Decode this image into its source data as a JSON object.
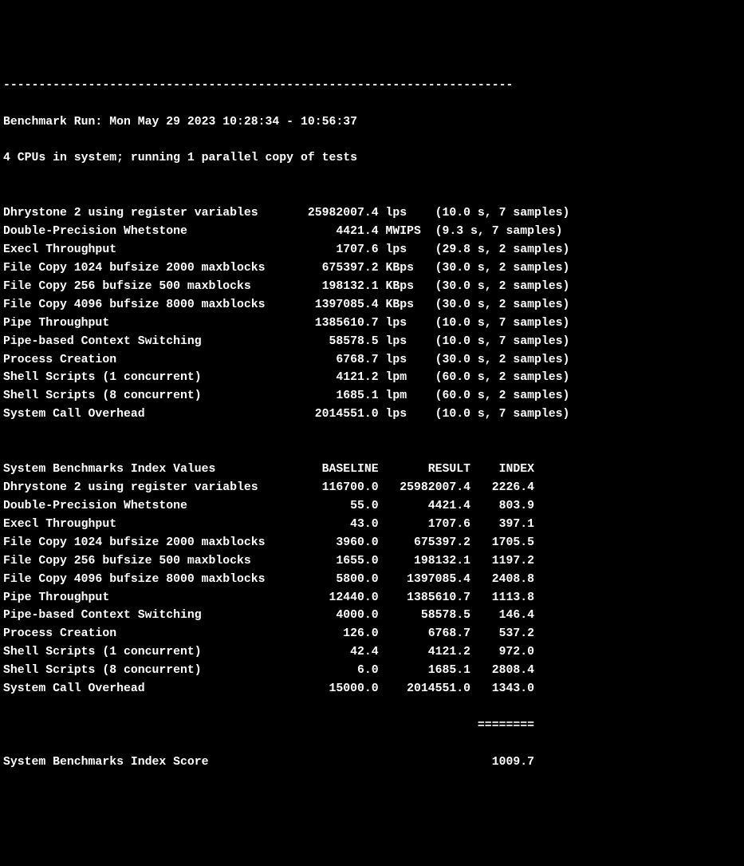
{
  "dashes_header": "------------------------------------------------------------------------",
  "run_info": "Benchmark Run: Mon May 29 2023 10:28:34 - 10:56:37",
  "cpu_info": "4 CPUs in system; running 1 parallel copy of tests",
  "blank": "",
  "results": [
    {
      "name": "Dhrystone 2 using register variables",
      "value": "25982007.4",
      "unit": "lps",
      "timing": "(10.0 s, 7 samples)"
    },
    {
      "name": "Double-Precision Whetstone",
      "value": "4421.4",
      "unit": "MWIPS",
      "timing": "(9.3 s, 7 samples)"
    },
    {
      "name": "Execl Throughput",
      "value": "1707.6",
      "unit": "lps",
      "timing": "(29.8 s, 2 samples)"
    },
    {
      "name": "File Copy 1024 bufsize 2000 maxblocks",
      "value": "675397.2",
      "unit": "KBps",
      "timing": "(30.0 s, 2 samples)"
    },
    {
      "name": "File Copy 256 bufsize 500 maxblocks",
      "value": "198132.1",
      "unit": "KBps",
      "timing": "(30.0 s, 2 samples)"
    },
    {
      "name": "File Copy 4096 bufsize 8000 maxblocks",
      "value": "1397085.4",
      "unit": "KBps",
      "timing": "(30.0 s, 2 samples)"
    },
    {
      "name": "Pipe Throughput",
      "value": "1385610.7",
      "unit": "lps",
      "timing": "(10.0 s, 7 samples)"
    },
    {
      "name": "Pipe-based Context Switching",
      "value": "58578.5",
      "unit": "lps",
      "timing": "(10.0 s, 7 samples)"
    },
    {
      "name": "Process Creation",
      "value": "6768.7",
      "unit": "lps",
      "timing": "(30.0 s, 2 samples)"
    },
    {
      "name": "Shell Scripts (1 concurrent)",
      "value": "4121.2",
      "unit": "lpm",
      "timing": "(60.0 s, 2 samples)"
    },
    {
      "name": "Shell Scripts (8 concurrent)",
      "value": "1685.1",
      "unit": "lpm",
      "timing": "(60.0 s, 2 samples)"
    },
    {
      "name": "System Call Overhead",
      "value": "2014551.0",
      "unit": "lps",
      "timing": "(10.0 s, 7 samples)"
    }
  ],
  "index_header": {
    "name": "System Benchmarks Index Values",
    "baseline": "BASELINE",
    "result": "RESULT",
    "index": "INDEX"
  },
  "index_rows": [
    {
      "name": "Dhrystone 2 using register variables",
      "baseline": "116700.0",
      "result": "25982007.4",
      "index": "2226.4"
    },
    {
      "name": "Double-Precision Whetstone",
      "baseline": "55.0",
      "result": "4421.4",
      "index": "803.9"
    },
    {
      "name": "Execl Throughput",
      "baseline": "43.0",
      "result": "1707.6",
      "index": "397.1"
    },
    {
      "name": "File Copy 1024 bufsize 2000 maxblocks",
      "baseline": "3960.0",
      "result": "675397.2",
      "index": "1705.5"
    },
    {
      "name": "File Copy 256 bufsize 500 maxblocks",
      "baseline": "1655.0",
      "result": "198132.1",
      "index": "1197.2"
    },
    {
      "name": "File Copy 4096 bufsize 8000 maxblocks",
      "baseline": "5800.0",
      "result": "1397085.4",
      "index": "2408.8"
    },
    {
      "name": "Pipe Throughput",
      "baseline": "12440.0",
      "result": "1385610.7",
      "index": "1113.8"
    },
    {
      "name": "Pipe-based Context Switching",
      "baseline": "4000.0",
      "result": "58578.5",
      "index": "146.4"
    },
    {
      "name": "Process Creation",
      "baseline": "126.0",
      "result": "6768.7",
      "index": "537.2"
    },
    {
      "name": "Shell Scripts (1 concurrent)",
      "baseline": "42.4",
      "result": "4121.2",
      "index": "972.0"
    },
    {
      "name": "Shell Scripts (8 concurrent)",
      "baseline": "6.0",
      "result": "1685.1",
      "index": "2808.4"
    },
    {
      "name": "System Call Overhead",
      "baseline": "15000.0",
      "result": "2014551.0",
      "index": "1343.0"
    }
  ],
  "score_separator_indent": "                                                                   ========",
  "score_label": "System Benchmarks Index Score",
  "score_value": "1009.7"
}
